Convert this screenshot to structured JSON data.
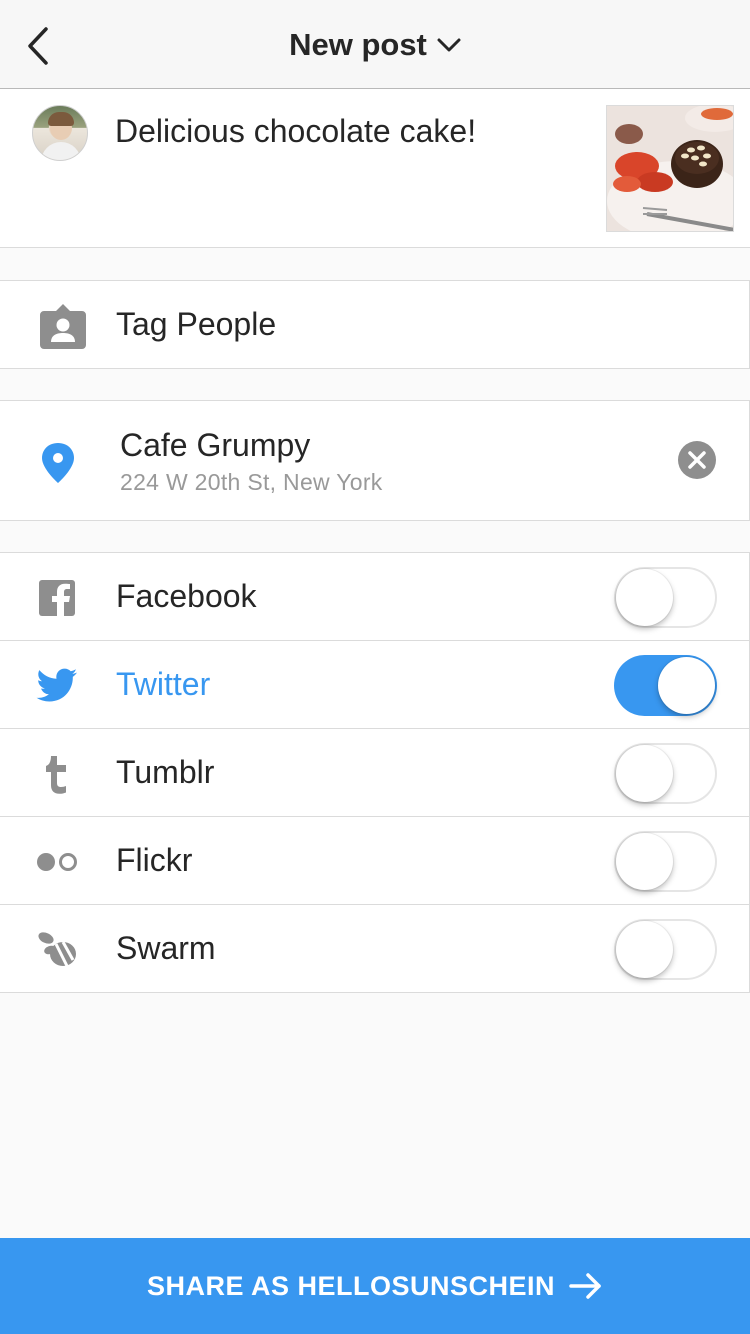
{
  "header": {
    "title": "New post"
  },
  "post": {
    "caption": "Delicious chocolate cake!"
  },
  "tag_people": {
    "label": "Tag People"
  },
  "location": {
    "name": "Cafe Grumpy",
    "address": "224 W 20th St, New York"
  },
  "share_to": [
    {
      "label": "Facebook",
      "icon": "facebook-icon",
      "enabled": false
    },
    {
      "label": "Twitter",
      "icon": "twitter-icon",
      "enabled": true
    },
    {
      "label": "Tumblr",
      "icon": "tumblr-icon",
      "enabled": false
    },
    {
      "label": "Flickr",
      "icon": "flickr-icon",
      "enabled": false
    },
    {
      "label": "Swarm",
      "icon": "swarm-icon",
      "enabled": false
    }
  ],
  "footer": {
    "share_label": "SHARE AS HELLOSUNSCHEIN"
  },
  "colors": {
    "accent": "#3897f0",
    "icon_gray": "#8e8e8e",
    "text": "#262626",
    "secondary_text": "#999999",
    "background": "#fafafa"
  }
}
